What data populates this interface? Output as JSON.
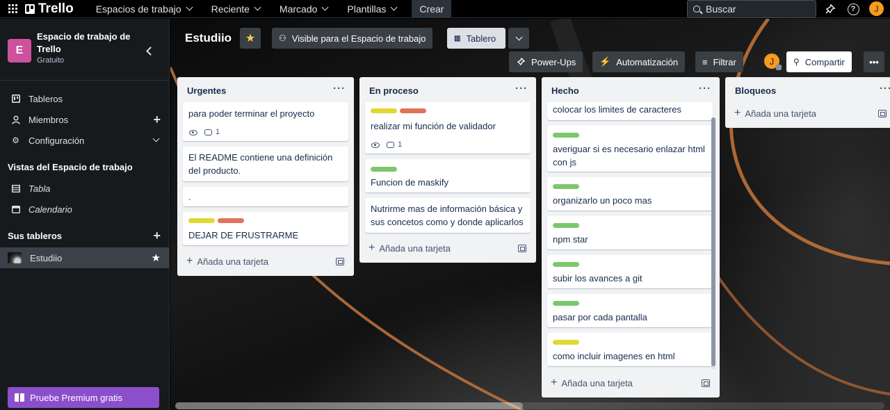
{
  "topbar": {
    "app_name": "Trello",
    "nav": [
      {
        "label": "Espacios de trabajo",
        "icon": "chevron-down-icon"
      },
      {
        "label": "Reciente",
        "icon": "chevron-down-icon"
      },
      {
        "label": "Marcado",
        "icon": "chevron-down-icon"
      },
      {
        "label": "Plantillas",
        "icon": "chevron-down-icon"
      }
    ],
    "create_label": "Crear",
    "search_placeholder": "Buscar",
    "user_initial": "J"
  },
  "sidebar": {
    "workspace_initial": "E",
    "workspace_name": "Espacio de trabajo de Trello",
    "workspace_plan": "Gratuito",
    "items": [
      {
        "label": "Tableros",
        "icon": "board-icon"
      },
      {
        "label": "Miembros",
        "icon": "person-icon"
      },
      {
        "label": "Configuración",
        "icon": "gear-icon"
      }
    ],
    "views_heading": "Vistas del Espacio de trabajo",
    "views": [
      {
        "label": "Tabla",
        "icon": "table-icon"
      },
      {
        "label": "Calendario",
        "icon": "calendar-icon"
      }
    ],
    "boards_heading": "Sus tableros",
    "boards": [
      {
        "label": "Estudiio"
      }
    ],
    "premium_label": "Pruebe Premium gratis"
  },
  "board": {
    "title": "Estudiio",
    "visibility_label": "Visible para el Espacio de trabajo",
    "view_label": "Tablero",
    "powerups_label": "Power-Ups",
    "automation_label": "Automatización",
    "filter_label": "Filtrar",
    "share_label": "Compartir",
    "member_initial": "J"
  },
  "lists": [
    {
      "title": "Urgentes",
      "cards": [
        {
          "text": "para poder terminar el proyecto",
          "labels": [],
          "watch": true,
          "comments": "1"
        },
        {
          "text": "El README contiene una definición del producto.",
          "labels": []
        },
        {
          "text": ".",
          "labels": []
        },
        {
          "text": "DEJAR DE FRUSTRARME",
          "labels": [
            "yellow",
            "red"
          ]
        }
      ],
      "add_label": "Añada una tarjeta"
    },
    {
      "title": "En proceso",
      "cards": [
        {
          "text": "realizar mi función de validador",
          "labels": [
            "yellow",
            "red"
          ],
          "watch": true,
          "comments": "1"
        },
        {
          "text": "Funcion de maskify",
          "labels": [
            "green"
          ]
        },
        {
          "text": "Nutrirme mas de información básica y sus concetos como y donde aplicarlos",
          "labels": []
        }
      ],
      "add_label": "Añada una tarjeta"
    },
    {
      "title": "Hecho",
      "cards": [
        {
          "text": "colocar los limites de caracteres",
          "labels": []
        },
        {
          "text": "averiguar si es necesario enlazar html con js",
          "labels": [
            "green"
          ]
        },
        {
          "text": "organizarlo un poco mas",
          "labels": [
            "green"
          ]
        },
        {
          "text": "npm star",
          "labels": [
            "green"
          ]
        },
        {
          "text": "subir los avances a git",
          "labels": [
            "green"
          ]
        },
        {
          "text": "pasar por cada pantalla",
          "labels": [
            "green"
          ]
        },
        {
          "text": "como incluir imagenes en html",
          "labels": [
            "yellow"
          ]
        }
      ],
      "add_label": "Añada una tarjeta"
    },
    {
      "title": "Bloqueos",
      "cards": [],
      "add_label": "Añada una tarjeta"
    }
  ],
  "colors": {
    "label_yellow": "#e2d733",
    "label_red": "#e2725b",
    "label_green": "#7bc86c",
    "premium_purple": "#8b4fcc",
    "workspace_badge": "#cd519d",
    "avatar_orange": "#f59b1d"
  }
}
